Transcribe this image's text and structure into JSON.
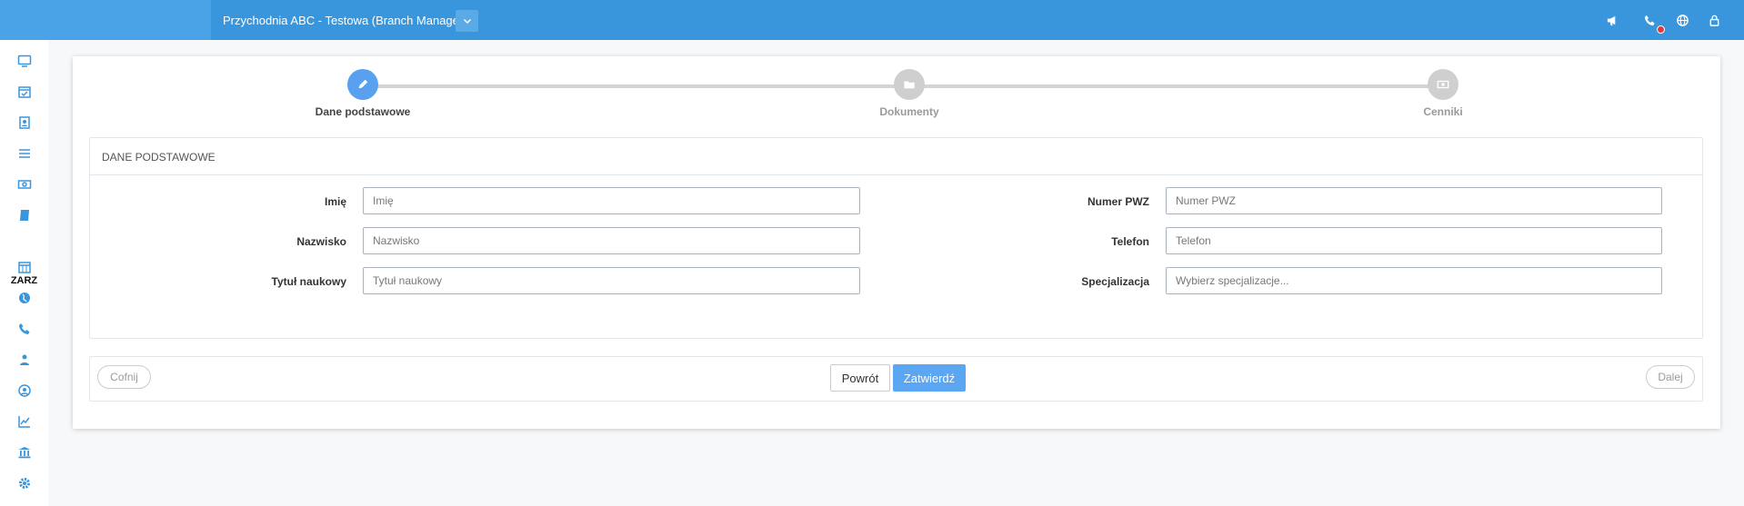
{
  "topbar": {
    "org_title": "Przychodnia ABC - Testowa (Branch Manager)",
    "icons": [
      "chevron-down-icon",
      "megaphone-icon",
      "phone-icon",
      "globe-icon",
      "lock-icon"
    ]
  },
  "sidebar": {
    "section_label": "ZARZ",
    "items": [
      "monitor-icon",
      "calendar-check-icon",
      "contacts-icon",
      "list-icon",
      "money-icon",
      "book-icon",
      "calendar-icon",
      "globe-icon",
      "phone-icon",
      "users-icon",
      "user-circle-icon",
      "chart-line-icon",
      "bank-icon",
      "gear-icon"
    ]
  },
  "stepper": {
    "steps": [
      {
        "label": "Dane podstawowe",
        "state": "active",
        "icon": "pencil-icon"
      },
      {
        "label": "Dokumenty",
        "state": "inactive",
        "icon": "folder-icon"
      },
      {
        "label": "Cenniki",
        "state": "inactive",
        "icon": "money-icon"
      }
    ]
  },
  "panel": {
    "title": "DANE PODSTAWOWE",
    "fields": {
      "imie": {
        "label": "Imię",
        "placeholder": "Imię",
        "value": ""
      },
      "nazwisko": {
        "label": "Nazwisko",
        "placeholder": "Nazwisko",
        "value": ""
      },
      "tytul": {
        "label": "Tytuł naukowy",
        "placeholder": "Tytuł naukowy",
        "value": ""
      },
      "pwz": {
        "label": "Numer PWZ",
        "placeholder": "Numer PWZ",
        "value": ""
      },
      "telefon": {
        "label": "Telefon",
        "placeholder": "Telefon",
        "value": ""
      },
      "specjalizacja": {
        "label": "Specjalizacja",
        "placeholder": "Wybierz specjalizacje...",
        "value": ""
      }
    }
  },
  "footer": {
    "back_label": "Cofnij",
    "return_label": "Powrót",
    "confirm_label": "Zatwierdź",
    "next_label": "Dalej"
  },
  "colors": {
    "topbar": "#3a96dc",
    "accent": "#59a1ee",
    "sidebar_icon": "#3a96dc",
    "notification": "#e53935"
  }
}
